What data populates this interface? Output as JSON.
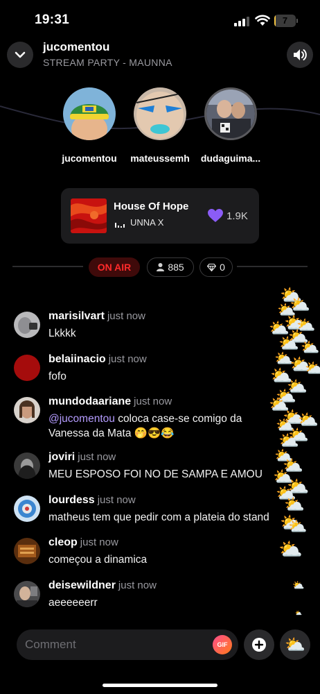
{
  "status_bar": {
    "time": "19:31",
    "battery_level": "7",
    "battery_fraction": 0.07
  },
  "header": {
    "title": "jucomentou",
    "subtitle": "STREAM PARTY - MAUNNA"
  },
  "participants": [
    {
      "name": "jucomentou"
    },
    {
      "name": "mateussemh"
    },
    {
      "name": "dudaguima..."
    }
  ],
  "now_playing": {
    "title": "House Of Hope",
    "artist": "UNNA X",
    "likes": "1.9K"
  },
  "stream": {
    "status": "ON AIR",
    "viewers": "885",
    "gems": "0"
  },
  "comments": [
    {
      "user": "marisilvart",
      "time": "just now",
      "text": "Lkkkk"
    },
    {
      "user": "belaiinacio",
      "time": "just now",
      "text": "fofo"
    },
    {
      "user": "mundodaariane",
      "time": "just now",
      "mention": "@jucomentou",
      "text": "coloca case-se comigo da",
      "text2": "Vanessa da Mata 🤭😎😂"
    },
    {
      "user": "joviri",
      "time": "just now",
      "text": "MEU ESPOSO FOI NO DE SAMPA E AMOU"
    },
    {
      "user": "lourdess",
      "time": "just now",
      "text": "matheus tem que pedir com a plateia do stand"
    },
    {
      "user": "cleop",
      "time": "just now",
      "text": "começou a dinamica"
    },
    {
      "user": "deisewildner",
      "time": "just now",
      "text": "aeeeeeerr"
    }
  ],
  "composer": {
    "placeholder": "Comment",
    "gif_label": "GIF"
  },
  "reaction_emoji": "⛅",
  "colors": {
    "background": "#000000",
    "on_air": "#ff2a2a",
    "mention": "#b59cff",
    "heart": "#8b5cf6"
  }
}
